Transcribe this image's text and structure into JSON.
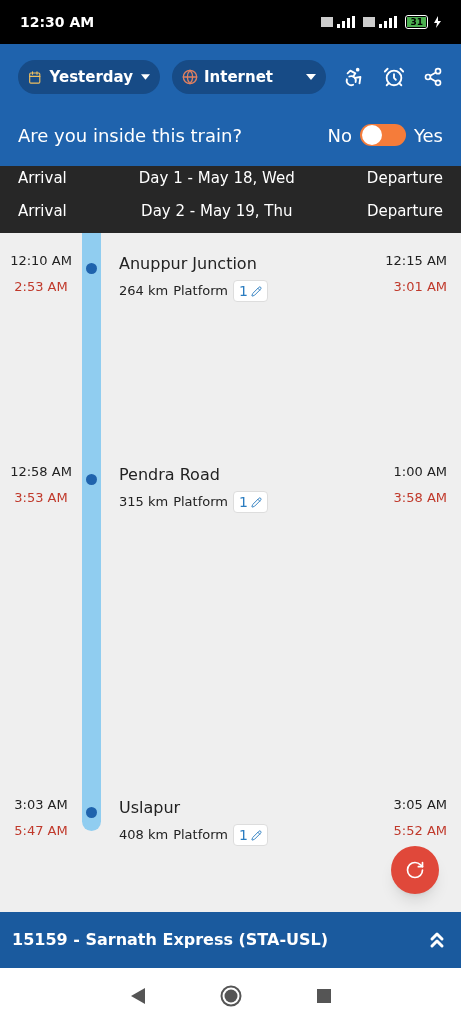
{
  "status_bar": {
    "time": "12:30 AM",
    "battery": "31"
  },
  "toolbar": {
    "date_filter": {
      "label": "Yesterday"
    },
    "source_filter": {
      "label": "Internet"
    }
  },
  "inside_train": {
    "question": "Are you inside this train?",
    "no_label": "No",
    "yes_label": "Yes",
    "on": false
  },
  "day_headers": [
    {
      "arrival": "Arrival",
      "day": "Day 1 - May 18, Wed",
      "departure": "Departure"
    },
    {
      "arrival": "Arrival",
      "day": "Day 2 - May 19, Thu",
      "departure": "Departure"
    }
  ],
  "stops": [
    {
      "name": "Anuppur Junction",
      "scheduled_arrival": "12:10 AM",
      "actual_arrival": "2:53 AM",
      "scheduled_departure": "12:15 AM",
      "actual_departure": "3:01 AM",
      "distance": "264 km",
      "platform_label": "Platform",
      "platform": "1"
    },
    {
      "name": "Pendra Road",
      "scheduled_arrival": "12:58 AM",
      "actual_arrival": "3:53 AM",
      "scheduled_departure": "1:00 AM",
      "actual_departure": "3:58 AM",
      "distance": "315 km",
      "platform_label": "Platform",
      "platform": "1"
    },
    {
      "name": "Uslapur",
      "scheduled_arrival": "3:03 AM",
      "actual_arrival": "5:47 AM",
      "scheduled_departure": "3:05 AM",
      "actual_departure": "5:52 AM",
      "distance": "408 km",
      "platform_label": "Platform",
      "platform": "1"
    }
  ],
  "train_bar": {
    "title": "15159 - Sarnath Express (STA-USL)"
  }
}
